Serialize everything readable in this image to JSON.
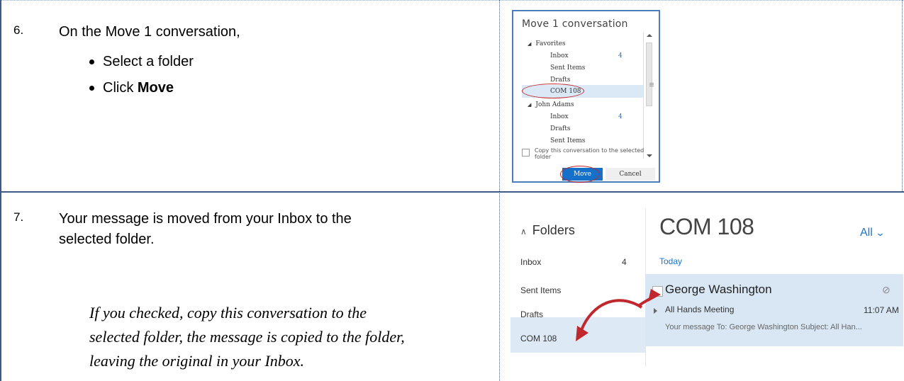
{
  "step6": {
    "number": "6.",
    "intro": "On the Move 1 conversation,",
    "bullets": [
      "Select a folder",
      "Click "
    ],
    "bold_word": "Move"
  },
  "step7": {
    "number": "7.",
    "line1": "Your message is moved from your Inbox to the",
    "line2": "selected folder.",
    "note_lines": [
      "If you checked, copy this conversation to the",
      "selected folder, the message is copied to the folder,",
      "leaving the original in your Inbox."
    ]
  },
  "move_dialog": {
    "title": "Move 1 conversation",
    "favorites_label": "Favorites",
    "favorites": [
      {
        "name": "Inbox",
        "count": "4"
      },
      {
        "name": "Sent Items",
        "count": ""
      },
      {
        "name": "Drafts",
        "count": ""
      },
      {
        "name": "COM 108",
        "count": ""
      }
    ],
    "account_label": "John Adams",
    "account_folders": [
      {
        "name": "Inbox",
        "count": "4"
      },
      {
        "name": "Drafts",
        "count": ""
      },
      {
        "name": "Sent Items",
        "count": ""
      }
    ],
    "copy_option": "Copy this conversation to the selected folder",
    "move_button": "Move",
    "cancel_button": "Cancel",
    "selected_folder": "COM 108"
  },
  "mail_view": {
    "folders_header": "Folders",
    "folders": [
      {
        "name": "Inbox",
        "count": "4"
      },
      {
        "name": "Sent Items",
        "count": ""
      },
      {
        "name": "Drafts",
        "count": ""
      },
      {
        "name": "COM 108",
        "count": ""
      }
    ],
    "folder_title": "COM 108",
    "filter": "All",
    "group_label": "Today",
    "message": {
      "sender": "George Washington",
      "subject": "All Hands Meeting",
      "time": "11:07 AM",
      "preview": "Your message  To: George Washington Subject: All Han..."
    }
  },
  "colors": {
    "table_border": "#3b5a86",
    "accent_blue": "#1570c9",
    "highlight_red": "#c0282d",
    "selection_bg": "#dde9f5"
  }
}
